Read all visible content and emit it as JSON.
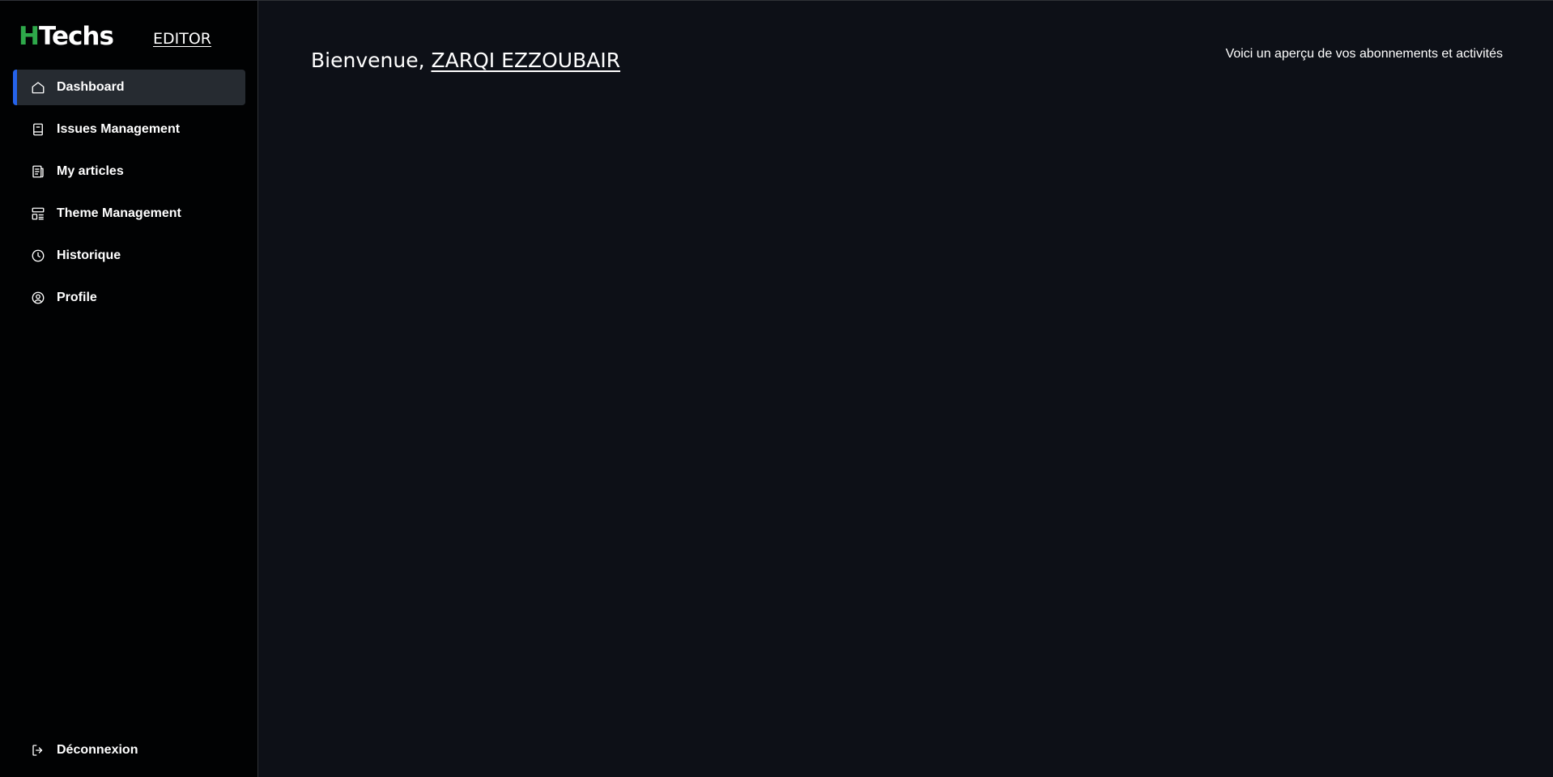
{
  "brand": {
    "logo_mark": "H",
    "logo_text": "Techs",
    "role": "EDITOR"
  },
  "sidebar": {
    "items": [
      {
        "label": "Dashboard",
        "icon": "home-icon",
        "active": true
      },
      {
        "label": "Issues Management",
        "icon": "book-icon",
        "active": false
      },
      {
        "label": "My articles",
        "icon": "newspaper-icon",
        "active": false
      },
      {
        "label": "Theme Management",
        "icon": "layout-icon",
        "active": false
      },
      {
        "label": "Historique",
        "icon": "clock-icon",
        "active": false
      },
      {
        "label": "Profile",
        "icon": "user-circle-icon",
        "active": false
      }
    ],
    "logout_label": "Déconnexion"
  },
  "main": {
    "welcome_prefix": "Bienvenue, ",
    "user_name": "ZARQI EZZOUBAIR",
    "subtitle": "Voici un aperçu de vos abonnements et activités"
  },
  "colors": {
    "accent": "#2563eb",
    "brand_green": "#2ea84a",
    "sidebar_bg": "#010203",
    "main_bg": "#0d1017",
    "active_bg": "#262b31"
  }
}
